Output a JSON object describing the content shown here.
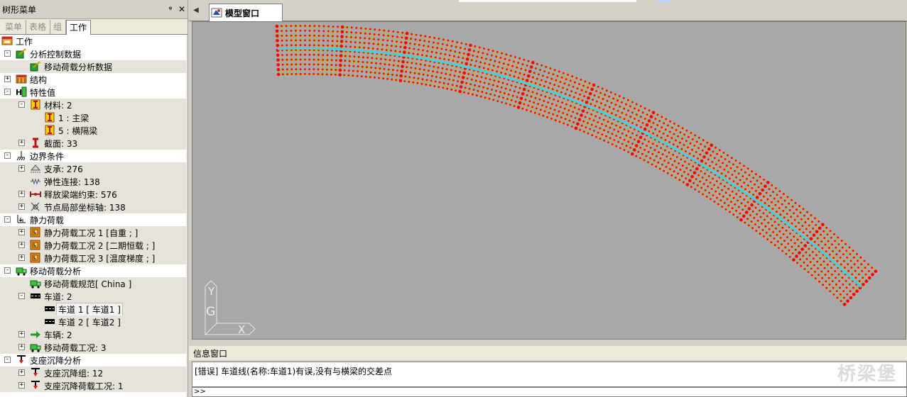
{
  "tree_panel": {
    "title": "树形菜单",
    "pin_glyph": "ᵠ",
    "close_glyph": "✕",
    "tabs": [
      "菜单",
      "表格",
      "组",
      "工作"
    ],
    "active_tab": 3
  },
  "tree": [
    {
      "label": "工作",
      "level": 0,
      "pm": "",
      "icon": "work-icon",
      "alt": false
    },
    {
      "label": "分析控制数据",
      "level": 1,
      "pm": "-",
      "icon": "analysis-control-icon",
      "alt": false
    },
    {
      "label": "移动荷载分析数据",
      "level": 2,
      "pm": "",
      "icon": "analysis-control-icon",
      "alt": true
    },
    {
      "label": "结构",
      "level": 1,
      "pm": "+",
      "icon": "structure-icon",
      "alt": false
    },
    {
      "label": "特性值",
      "level": 1,
      "pm": "-",
      "icon": "property-icon",
      "alt": false
    },
    {
      "label": "材料: 2",
      "level": 2,
      "pm": "-",
      "icon": "material-icon",
      "alt": true
    },
    {
      "label": "1 : 主梁",
      "level": 3,
      "pm": "",
      "icon": "material-icon",
      "alt": true
    },
    {
      "label": "5 : 横隔梁",
      "level": 3,
      "pm": "",
      "icon": "material-icon",
      "alt": true
    },
    {
      "label": "截面: 33",
      "level": 2,
      "pm": "+",
      "icon": "section-icon",
      "alt": true
    },
    {
      "label": "边界条件",
      "level": 1,
      "pm": "-",
      "icon": "boundary-icon",
      "alt": false
    },
    {
      "label": "支承: 276",
      "level": 2,
      "pm": "+",
      "icon": "support-icon",
      "alt": true
    },
    {
      "label": "弹性连接: 138",
      "level": 2,
      "pm": "",
      "icon": "elastic-link-icon",
      "alt": true
    },
    {
      "label": "释放梁端约束: 576",
      "level": 2,
      "pm": "+",
      "icon": "release-icon",
      "alt": true
    },
    {
      "label": "节点局部坐标轴: 138",
      "level": 2,
      "pm": "+",
      "icon": "local-axis-icon",
      "alt": true
    },
    {
      "label": "静力荷载",
      "level": 1,
      "pm": "-",
      "icon": "static-load-icon",
      "alt": false
    },
    {
      "label": "静力荷载工况 1 [自重 ; ]",
      "level": 2,
      "pm": "+",
      "icon": "load-case-icon",
      "alt": true
    },
    {
      "label": "静力荷载工况 2 [二期恒载 ; ]",
      "level": 2,
      "pm": "+",
      "icon": "load-case-icon",
      "alt": true
    },
    {
      "label": "静力荷载工况 3 [温度梯度 ; ]",
      "level": 2,
      "pm": "+",
      "icon": "load-case-icon",
      "alt": true
    },
    {
      "label": "移动荷载分析",
      "level": 1,
      "pm": "-",
      "icon": "moving-load-icon",
      "alt": false
    },
    {
      "label": "移动荷载规范[ China ]",
      "level": 2,
      "pm": "",
      "icon": "moving-load-icon",
      "alt": true
    },
    {
      "label": "车道: 2",
      "level": 2,
      "pm": "-",
      "icon": "lane-icon",
      "alt": true
    },
    {
      "label": "车道 1 [ 车道1 ]",
      "level": 3,
      "pm": "",
      "icon": "lane-icon",
      "alt": true,
      "sel": true
    },
    {
      "label": "车道 2 [ 车道2 ]",
      "level": 3,
      "pm": "",
      "icon": "lane-icon",
      "alt": true
    },
    {
      "label": "车辆: 2",
      "level": 2,
      "pm": "+",
      "icon": "vehicle-icon",
      "alt": true
    },
    {
      "label": "移动荷载工况: 3",
      "level": 2,
      "pm": "+",
      "icon": "moving-load-icon",
      "alt": true
    },
    {
      "label": "支座沉降分析",
      "level": 1,
      "pm": "-",
      "icon": "settlement-icon",
      "alt": false
    },
    {
      "label": "支座沉降组: 12",
      "level": 2,
      "pm": "+",
      "icon": "settlement-icon",
      "alt": true
    },
    {
      "label": "支座沉降荷载工况: 1",
      "level": 2,
      "pm": "+",
      "icon": "settlement-icon",
      "alt": true
    }
  ],
  "doc_tab": {
    "label": "模型窗口",
    "arrow": "◀"
  },
  "axis": {
    "y": "Y",
    "g": "G",
    "x": "X"
  },
  "info": {
    "title": "信息窗口",
    "message": "[错误] 车道线(名称:车道1)有误,没有与横梁的交差点",
    "prompt": ">>"
  },
  "watermark": "桥梁堡",
  "colors": {
    "mesh_node": "#ff0000",
    "mesh_line": "#d4b000",
    "lane_line": "#40d0e0",
    "viewport_bg": "#a8a8a8"
  }
}
